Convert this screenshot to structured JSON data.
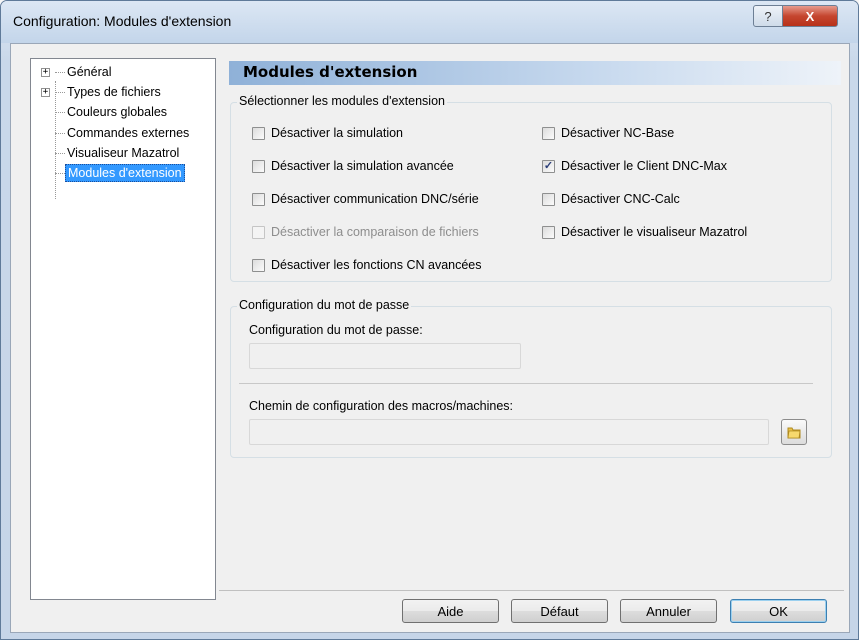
{
  "window": {
    "title": "Configuration: Modules d'extension",
    "help_label": "?",
    "close_label": "X"
  },
  "tree": {
    "items": [
      {
        "label": "Général",
        "expandable": true
      },
      {
        "label": "Types de fichiers",
        "expandable": true
      },
      {
        "label": "Couleurs globales",
        "expandable": false
      },
      {
        "label": "Commandes externes",
        "expandable": false
      },
      {
        "label": "Visualiseur Mazatrol",
        "expandable": false
      },
      {
        "label": "Modules d'extension",
        "expandable": false,
        "selected": true
      }
    ],
    "expand_glyph": "+"
  },
  "panel": {
    "title": "Modules d'extension"
  },
  "modules_group": {
    "title": "Sélectionner les modules d'extension",
    "left": [
      {
        "label": "Désactiver la simulation",
        "checked": false,
        "enabled": true
      },
      {
        "label": "Désactiver la simulation avancée",
        "checked": false,
        "enabled": true
      },
      {
        "label": "Désactiver communication DNC/série",
        "checked": false,
        "enabled": true
      },
      {
        "label": "Désactiver la comparaison de fichiers",
        "checked": false,
        "enabled": false
      },
      {
        "label": "Désactiver les fonctions CN avancées",
        "checked": false,
        "enabled": true
      }
    ],
    "right": [
      {
        "label": "Désactiver NC-Base",
        "checked": false,
        "enabled": true
      },
      {
        "label": "Désactiver le Client DNC-Max",
        "checked": true,
        "enabled": true
      },
      {
        "label": "Désactiver CNC-Calc",
        "checked": false,
        "enabled": true
      },
      {
        "label": "Désactiver le visualiseur Mazatrol",
        "checked": false,
        "enabled": true
      }
    ],
    "check_glyph": "✓"
  },
  "password_group": {
    "title": "Configuration du mot de passe",
    "password_label": "Configuration du mot de passe:",
    "password_value": "",
    "path_label": "Chemin de configuration des macros/machines:",
    "path_value": ""
  },
  "buttons": {
    "help": "Aide",
    "default": "Défaut",
    "cancel": "Annuler",
    "ok": "OK"
  },
  "colors": {
    "selection": "#3399ff",
    "header_gradient_start": "#8fb1d8",
    "close_button": "#c5462f"
  }
}
